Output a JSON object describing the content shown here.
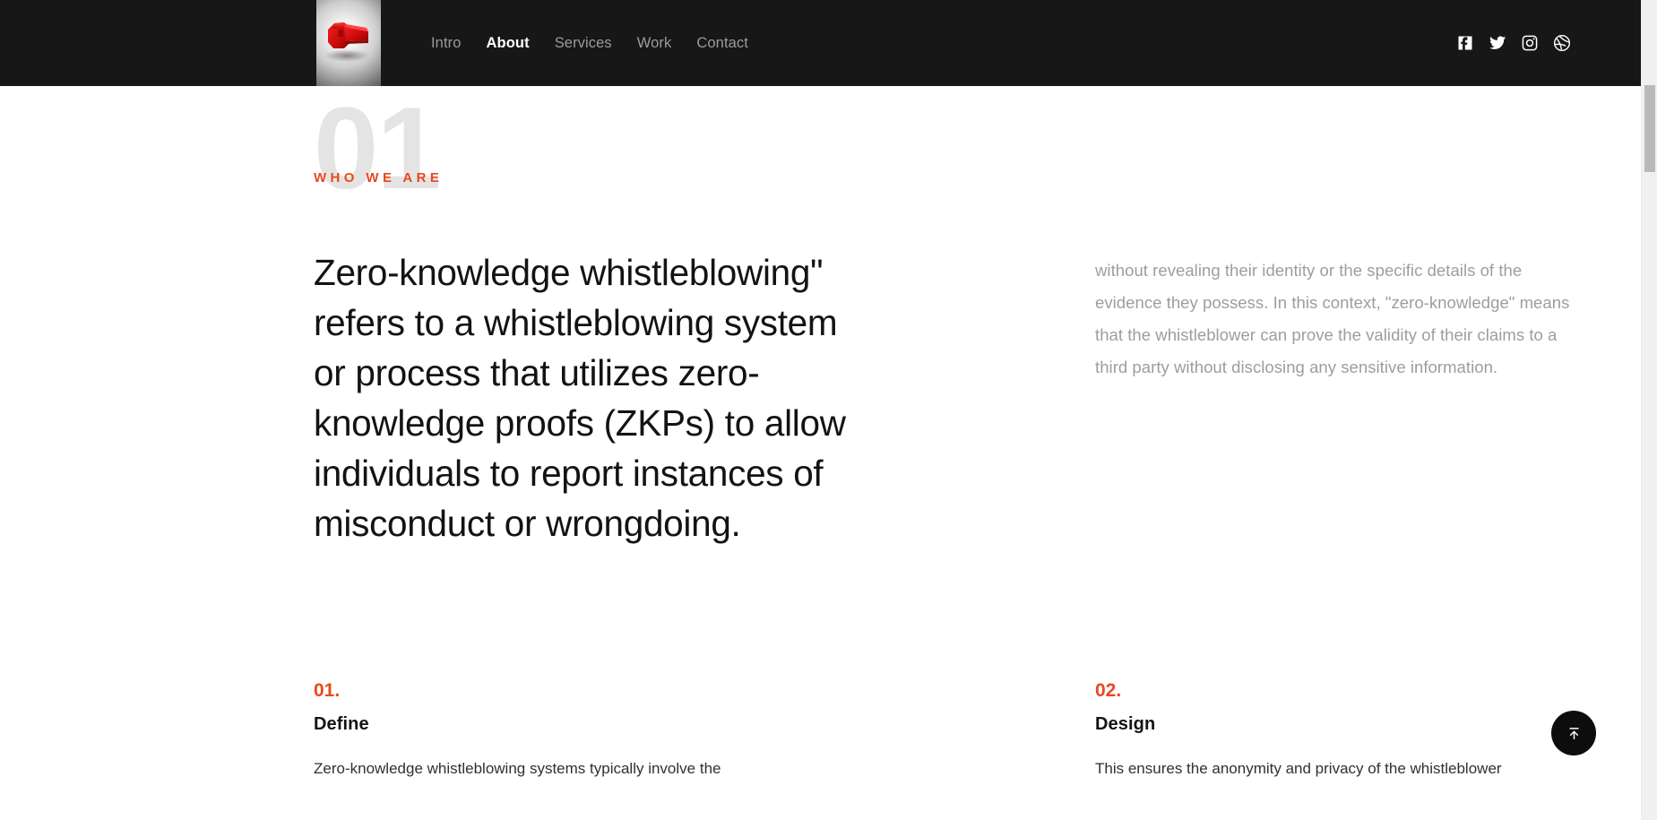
{
  "header": {
    "logo": {
      "name": "whistle-logo",
      "alt": "Red whistle logo",
      "color": "#d40e0e"
    },
    "nav": [
      {
        "label": "Intro",
        "active": false
      },
      {
        "label": "About",
        "active": true
      },
      {
        "label": "Services",
        "active": false
      },
      {
        "label": "Work",
        "active": false
      },
      {
        "label": "Contact",
        "active": false
      }
    ],
    "social": [
      {
        "name": "facebook-icon",
        "label": "Facebook"
      },
      {
        "name": "twitter-icon",
        "label": "Twitter"
      },
      {
        "name": "instagram-icon",
        "label": "Instagram"
      },
      {
        "name": "dribbble-icon",
        "label": "Dribbble"
      }
    ],
    "background_color": "#171717"
  },
  "section": {
    "number": "01",
    "kicker": "WHO WE ARE",
    "headline": "Zero-knowledge whistleblowing\" refers to a whistleblowing system or process that utilizes zero-knowledge proofs (ZKPs) to allow individuals to report instances of misconduct or wrongdoing.",
    "body": "without revealing their identity or the specific details of the evidence they possess. In this context, \"zero-knowledge\" means that the whistleblower can prove the validity of their claims to a third party without disclosing any sensitive information."
  },
  "cards": [
    {
      "number": "01.",
      "title": "Define",
      "text": "Zero-knowledge whistleblowing systems typically involve the"
    },
    {
      "number": "02.",
      "title": "Design",
      "text": "This ensures the anonymity and privacy of the whistleblower"
    }
  ],
  "floating": {
    "scroll_top": {
      "name": "scroll-to-top-icon",
      "label": "Back to top"
    }
  },
  "accent_color": "#e9481e",
  "theme": {
    "number_gray": "#e4e4e4",
    "body_gray": "#9a9ea3",
    "text_dark": "#131313"
  }
}
